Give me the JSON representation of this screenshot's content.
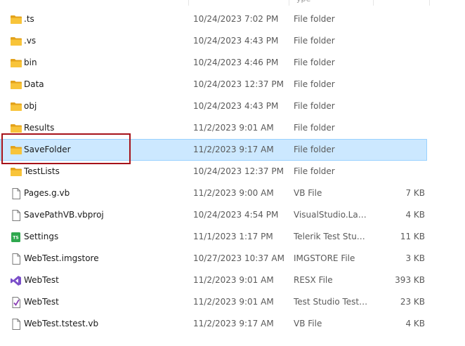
{
  "header": {
    "type_fragment": "ype"
  },
  "rows": [
    {
      "name": ".ts",
      "date": "10/24/2023 7:02 PM",
      "type": "File folder",
      "size": "",
      "icon": "folder-icon",
      "selected": false
    },
    {
      "name": ".vs",
      "date": "10/24/2023 4:43 PM",
      "type": "File folder",
      "size": "",
      "icon": "folder-icon",
      "selected": false
    },
    {
      "name": "bin",
      "date": "10/24/2023 4:46 PM",
      "type": "File folder",
      "size": "",
      "icon": "folder-icon",
      "selected": false
    },
    {
      "name": "Data",
      "date": "10/24/2023 12:37 PM",
      "type": "File folder",
      "size": "",
      "icon": "folder-icon",
      "selected": false
    },
    {
      "name": "obj",
      "date": "10/24/2023 4:43 PM",
      "type": "File folder",
      "size": "",
      "icon": "folder-icon",
      "selected": false
    },
    {
      "name": "Results",
      "date": "11/2/2023 9:01 AM",
      "type": "File folder",
      "size": "",
      "icon": "folder-icon",
      "selected": false
    },
    {
      "name": "SaveFolder",
      "date": "11/2/2023 9:17 AM",
      "type": "File folder",
      "size": "",
      "icon": "folder-icon",
      "selected": true
    },
    {
      "name": "TestLists",
      "date": "10/24/2023 12:37 PM",
      "type": "File folder",
      "size": "",
      "icon": "folder-icon",
      "selected": false
    },
    {
      "name": "Pages.g.vb",
      "date": "11/2/2023 9:00 AM",
      "type": "VB File",
      "size": "7 KB",
      "icon": "file-icon",
      "selected": false
    },
    {
      "name": "SavePathVB.vbproj",
      "date": "10/24/2023 4:54 PM",
      "type": "VisualStudio.Laun...",
      "size": "4 KB",
      "icon": "file-icon",
      "selected": false
    },
    {
      "name": "Settings",
      "date": "11/1/2023 1:17 PM",
      "type": "Telerik Test Studio ...",
      "size": "11 KB",
      "icon": "test-studio-settings-icon",
      "selected": false
    },
    {
      "name": "WebTest.imgstore",
      "date": "10/27/2023 10:37 AM",
      "type": "IMGSTORE File",
      "size": "3 KB",
      "icon": "file-icon",
      "selected": false
    },
    {
      "name": "WebTest",
      "date": "11/2/2023 9:01 AM",
      "type": "RESX File",
      "size": "393 KB",
      "icon": "visual-studio-icon",
      "selected": false
    },
    {
      "name": "WebTest",
      "date": "11/2/2023 9:01 AM",
      "type": "Test Studio Test File",
      "size": "23 KB",
      "icon": "test-file-check-icon",
      "selected": false
    },
    {
      "name": "WebTest.tstest.vb",
      "date": "11/2/2023 9:17 AM",
      "type": "VB File",
      "size": "4 KB",
      "icon": "file-icon",
      "selected": false
    }
  ],
  "colors": {
    "selection_bg": "#cce8ff",
    "selection_border": "#99d1ff",
    "highlight_box": "#a6121a",
    "folder_yellow": "#f8c43a",
    "vs_purple": "#7b4fc9",
    "test_studio_green": "#2fa84f"
  }
}
